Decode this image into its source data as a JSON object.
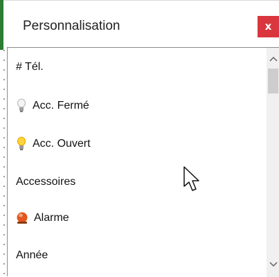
{
  "window": {
    "title": "Personnalisation",
    "close_label": "x",
    "accent_color": "#d9363e"
  },
  "list": {
    "items": [
      {
        "label": "# Tél.",
        "icon": null
      },
      {
        "label": "Acc. Fermé",
        "icon": "lightbulb-off-icon"
      },
      {
        "label": "Acc. Ouvert",
        "icon": "lightbulb-on-icon"
      },
      {
        "label": "Accessoires",
        "icon": null
      },
      {
        "label": "Alarme",
        "icon": "alarm-light-icon"
      },
      {
        "label": "Année",
        "icon": null
      }
    ]
  },
  "scrollbar": {
    "up_glyph": "^",
    "down_glyph": "v"
  }
}
